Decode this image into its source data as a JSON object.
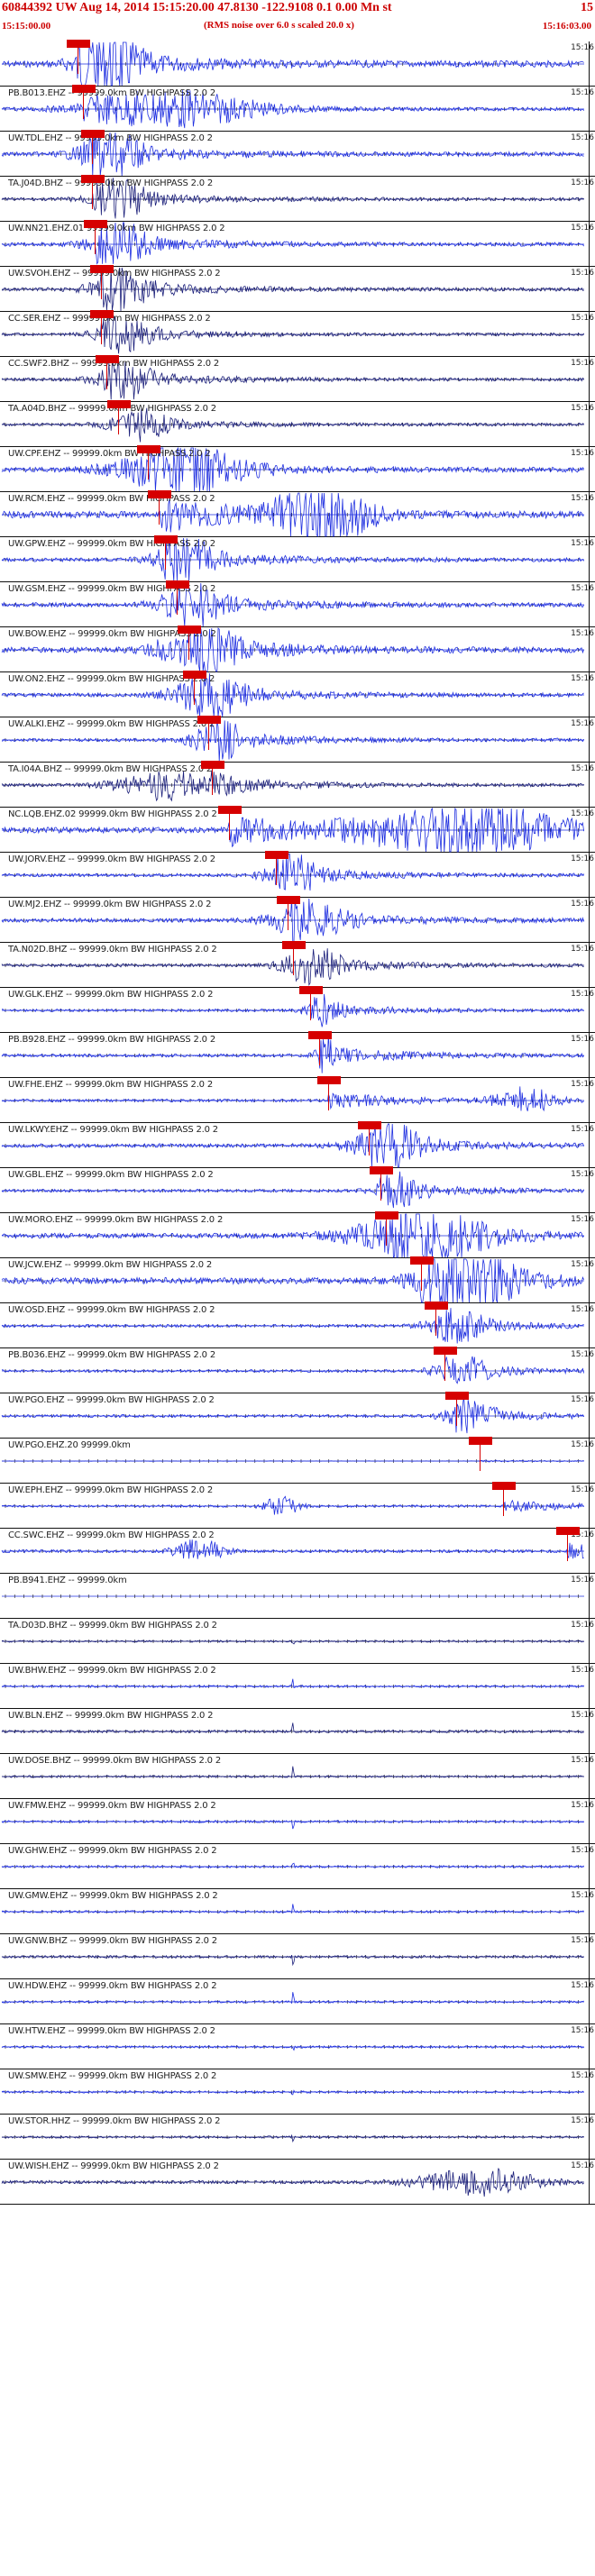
{
  "header": {
    "title": "60844392 UW Aug 14, 2014 15:15:20.00   47.8130 -122.9108  0.1 0.00 Mn st",
    "title_right": "15",
    "subtitle": "(RMS noise over 6.0 s scaled 20.0 x)",
    "start_time": "15:15:00.00",
    "end_time": "15:16:03.00"
  },
  "colors": {
    "header_red": "#cc0000",
    "trace_blue": "#1f2fe0",
    "trace_navy": "#1b1f7a",
    "pick_red": "#d60000"
  },
  "trace_time_label": "15:16",
  "traces": [
    {
      "label": "",
      "color": "#1f2fe0",
      "pick": 0.13,
      "amp": 0.9,
      "burst": [
        0.18,
        0.05
      ]
    },
    {
      "label": "PB.B013.EHZ -- 99999.0km BW  HIGHPASS  2.0  2",
      "color": "#1f2fe0",
      "pick": 0.14,
      "amp": 0.5,
      "burst": [
        0.3,
        0.14
      ]
    },
    {
      "label": "UW.TDL.EHZ -- 99999.0km BW  HIGHPASS  2.0  2",
      "color": "#1f2fe0",
      "pick": 0.155,
      "amp": 0.6,
      "burst": [
        0.18,
        0.05
      ]
    },
    {
      "label": "TA.J04D.BHZ -- 99999.0km BW  HIGHPASS  2.0  2",
      "color": "#1b1f7a",
      "pick": 0.155,
      "amp": 0.45,
      "burst": [
        0.2,
        0.05
      ]
    },
    {
      "label": "UW.NN21.EHZ.01 99999.0km BW  HIGHPASS  2.0  2",
      "color": "#1f2fe0",
      "pick": 0.16,
      "amp": 0.55,
      "burst": [
        0.2,
        0.05
      ]
    },
    {
      "label": "UW.SVOH.EHZ -- 99999.0km BW  HIGHPASS  2.0  2",
      "color": "#1b1f7a",
      "pick": 0.17,
      "amp": 0.5,
      "burst": [
        0.2,
        0.05
      ]
    },
    {
      "label": "CC.SER.EHZ -- 99999.0km BW  HIGHPASS  2.0  2",
      "color": "#1b1f7a",
      "pick": 0.17,
      "amp": 0.4,
      "burst": [
        0.21,
        0.05
      ]
    },
    {
      "label": "CC.SWF2.BHZ -- 99999.0km BW  HIGHPASS  2.0  2",
      "color": "#1b1f7a",
      "pick": 0.18,
      "amp": 0.45,
      "burst": [
        0.21,
        0.05
      ]
    },
    {
      "label": "TA.A04D.BHZ -- 99999.0km BW  HIGHPASS  2.0  2",
      "color": "#1b1f7a",
      "pick": 0.2,
      "amp": 0.4,
      "burst": [
        0.23,
        0.05
      ]
    },
    {
      "label": "UW.CPF.EHZ -- 99999.0km BW  HIGHPASS  2.0  2",
      "color": "#1f2fe0",
      "pick": 0.25,
      "amp": 0.7,
      "burst": [
        0.3,
        0.1
      ]
    },
    {
      "label": "UW.RCM.EHZ -- 99999.0km BW  HIGHPASS  2.0  2",
      "color": "#1f2fe0",
      "pick": 0.27,
      "amp": 0.95,
      "burst": [
        0.55,
        0.08
      ]
    },
    {
      "label": "UW.GPW.EHZ -- 99999.0km BW  HIGHPASS  2.0  2",
      "color": "#1f2fe0",
      "pick": 0.28,
      "amp": 0.55,
      "burst": [
        0.31,
        0.05
      ]
    },
    {
      "label": "UW.GSM.EHZ -- 99999.0km BW  HIGHPASS  2.0  2",
      "color": "#1f2fe0",
      "pick": 0.3,
      "amp": 0.6,
      "burst": [
        0.32,
        0.05
      ]
    },
    {
      "label": "UW.BOW.EHZ -- 99999.0km BW  HIGHPASS  2.0  2",
      "color": "#1f2fe0",
      "pick": 0.32,
      "amp": 0.75,
      "burst": [
        0.33,
        0.06
      ]
    },
    {
      "label": "UW.ON2.EHZ -- 99999.0km BW  HIGHPASS  2.0  2",
      "color": "#1f2fe0",
      "pick": 0.33,
      "amp": 0.55,
      "burst": [
        0.35,
        0.06
      ]
    },
    {
      "label": "UW.ALKI.EHZ -- 99999.0km BW  HIGHPASS  2.0  2",
      "color": "#1f2fe0",
      "pick": 0.355,
      "amp": 0.45,
      "burst": [
        0.37,
        0.05
      ]
    },
    {
      "label": "TA.I04A.BHZ -- 99999.0km BW  HIGHPASS  2.0  2",
      "color": "#1b1f7a",
      "pick": 0.36,
      "amp": 0.45,
      "burst": [
        0.28,
        0.08
      ]
    },
    {
      "label": "NC.LQB.EHZ.02 99999.0km BW  HIGHPASS  2.0  2",
      "color": "#1f2fe0",
      "pick": 0.39,
      "amp": 0.8,
      "burst": [
        0.8,
        0.18
      ]
    },
    {
      "label": "UW.JORV.EHZ -- 99999.0km BW  HIGHPASS  2.0  2",
      "color": "#1f2fe0",
      "pick": 0.47,
      "amp": 0.45,
      "burst": [
        0.5,
        0.05
      ]
    },
    {
      "label": "UW.MJ2.EHZ -- 99999.0km BW  HIGHPASS  2.0  2",
      "color": "#1f2fe0",
      "pick": 0.49,
      "amp": 0.55,
      "burst": [
        0.52,
        0.06
      ]
    },
    {
      "label": "TA.N02D.BHZ -- 99999.0km BW  HIGHPASS  2.0  2",
      "color": "#1b1f7a",
      "pick": 0.5,
      "amp": 0.45,
      "burst": [
        0.53,
        0.05
      ]
    },
    {
      "label": "UW.GLK.EHZ -- 99999.0km BW  HIGHPASS  2.0  2",
      "color": "#1f2fe0",
      "pick": 0.53,
      "amp": 0.35,
      "burst": [
        0.55,
        0.03
      ]
    },
    {
      "label": "PB.B928.EHZ -- 99999.0km BW  HIGHPASS  2.0  2",
      "color": "#1f2fe0",
      "pick": 0.545,
      "amp": 0.45,
      "burst": [
        0.56,
        0.02
      ]
    },
    {
      "label": "UW.FHE.EHZ -- 99999.0km BW  HIGHPASS  2.0  2",
      "color": "#1f2fe0",
      "pick": 0.56,
      "amp": 0.4,
      "burst": [
        0.9,
        0.05
      ]
    },
    {
      "label": "UW.LKWY.EHZ -- 99999.0km BW  HIGHPASS  2.0  2",
      "color": "#1f2fe0",
      "pick": 0.63,
      "amp": 0.55,
      "burst": [
        0.66,
        0.06
      ]
    },
    {
      "label": "UW.GBL.EHZ -- 99999.0km BW  HIGHPASS  2.0  2",
      "color": "#1f2fe0",
      "pick": 0.65,
      "amp": 0.4,
      "burst": [
        0.68,
        0.04
      ]
    },
    {
      "label": "UW.MORO.EHZ -- 99999.0km BW  HIGHPASS  2.0  2",
      "color": "#1f2fe0",
      "pick": 0.66,
      "amp": 0.7,
      "burst": [
        0.72,
        0.12
      ]
    },
    {
      "label": "UW.JCW.EHZ -- 99999.0km BW  HIGHPASS  2.0  2",
      "color": "#1f2fe0",
      "pick": 0.72,
      "amp": 0.9,
      "burst": [
        0.8,
        0.08
      ]
    },
    {
      "label": "UW.OSD.EHZ -- 99999.0km BW  HIGHPASS  2.0  2",
      "color": "#1f2fe0",
      "pick": 0.745,
      "amp": 0.4,
      "burst": [
        0.78,
        0.05
      ]
    },
    {
      "label": "PB.B036.EHZ -- 99999.0km BW  HIGHPASS  2.0  2",
      "color": "#1f2fe0",
      "pick": 0.76,
      "amp": 0.35,
      "burst": [
        0.79,
        0.05
      ]
    },
    {
      "label": "UW.PGO.EHZ -- 99999.0km BW  HIGHPASS  2.0  2",
      "color": "#1f2fe0",
      "pick": 0.78,
      "amp": 0.4,
      "burst": [
        0.8,
        0.04
      ]
    },
    {
      "label": "UW.PGO.EHZ.20 99999.0km",
      "color": "#1f2fe0",
      "pick": 0.82,
      "amp": 0.05,
      "burst": [
        0.5,
        0.0
      ]
    },
    {
      "label": "UW.EPH.EHZ -- 99999.0km BW  HIGHPASS  2.0  2",
      "color": "#1f2fe0",
      "pick": 0.86,
      "amp": 0.3,
      "burst": [
        0.48,
        0.03
      ]
    },
    {
      "label": "CC.SWC.EHZ -- 99999.0km BW  HIGHPASS  2.0  2",
      "color": "#1f2fe0",
      "pick": 0.97,
      "amp": 0.4,
      "burst": [
        0.34,
        0.04
      ]
    },
    {
      "label": "PB.B941.EHZ -- 99999.0km",
      "color": "#1f2fe0",
      "pick": null,
      "amp": 0.0,
      "burst": [
        0.5,
        0.0
      ]
    },
    {
      "label": "TA.D03D.BHZ -- 99999.0km BW  HIGHPASS  2.0  2",
      "color": "#1b1f7a",
      "pick": null,
      "amp": 0.25,
      "burst": [
        0.5,
        0.0
      ]
    },
    {
      "label": "UW.BHW.EHZ -- 99999.0km BW  HIGHPASS  2.0  2",
      "color": "#1f2fe0",
      "pick": null,
      "amp": 0.3,
      "burst": [
        0.5,
        0.0
      ]
    },
    {
      "label": "UW.BLN.EHZ -- 99999.0km BW  HIGHPASS  2.0  2",
      "color": "#1b1f7a",
      "pick": null,
      "amp": 0.35,
      "burst": [
        0.5,
        0.0
      ]
    },
    {
      "label": "UW.DOSE.BHZ -- 99999.0km BW  HIGHPASS  2.0  2",
      "color": "#1b1f7a",
      "pick": null,
      "amp": 0.3,
      "burst": [
        0.5,
        0.0
      ]
    },
    {
      "label": "UW.FMW.EHZ -- 99999.0km BW  HIGHPASS  2.0  2",
      "color": "#1f2fe0",
      "pick": null,
      "amp": 0.3,
      "burst": [
        0.5,
        0.0
      ]
    },
    {
      "label": "UW.GHW.EHZ -- 99999.0km BW  HIGHPASS  2.0  2",
      "color": "#1f2fe0",
      "pick": null,
      "amp": 0.3,
      "burst": [
        0.5,
        0.0
      ]
    },
    {
      "label": "UW.GMW.EHZ -- 99999.0km BW  HIGHPASS  2.0  2",
      "color": "#1f2fe0",
      "pick": null,
      "amp": 0.3,
      "burst": [
        0.5,
        0.0
      ]
    },
    {
      "label": "UW.GNW.BHZ -- 99999.0km BW  HIGHPASS  2.0  2",
      "color": "#1b1f7a",
      "pick": null,
      "amp": 0.35,
      "burst": [
        0.5,
        0.0
      ]
    },
    {
      "label": "UW.HDW.EHZ -- 99999.0km BW  HIGHPASS  2.0  2",
      "color": "#1f2fe0",
      "pick": null,
      "amp": 0.3,
      "burst": [
        0.5,
        0.0
      ]
    },
    {
      "label": "UW.HTW.EHZ -- 99999.0km BW  HIGHPASS  2.0  2",
      "color": "#1f2fe0",
      "pick": null,
      "amp": 0.3,
      "burst": [
        0.5,
        0.0
      ]
    },
    {
      "label": "UW.SMW.EHZ -- 99999.0km BW  HIGHPASS  2.0  2",
      "color": "#1f2fe0",
      "pick": null,
      "amp": 0.3,
      "burst": [
        0.5,
        0.0
      ]
    },
    {
      "label": "UW.STOR.HHZ -- 99999.0km BW  HIGHPASS  2.0  2",
      "color": "#1b1f7a",
      "pick": null,
      "amp": 0.3,
      "burst": [
        0.5,
        0.0
      ]
    },
    {
      "label": "UW.WISH.EHZ -- 99999.0km BW  HIGHPASS  2.0  2",
      "color": "#1b1f7a",
      "pick": null,
      "amp": 0.45,
      "burst": [
        0.82,
        0.1
      ]
    }
  ]
}
